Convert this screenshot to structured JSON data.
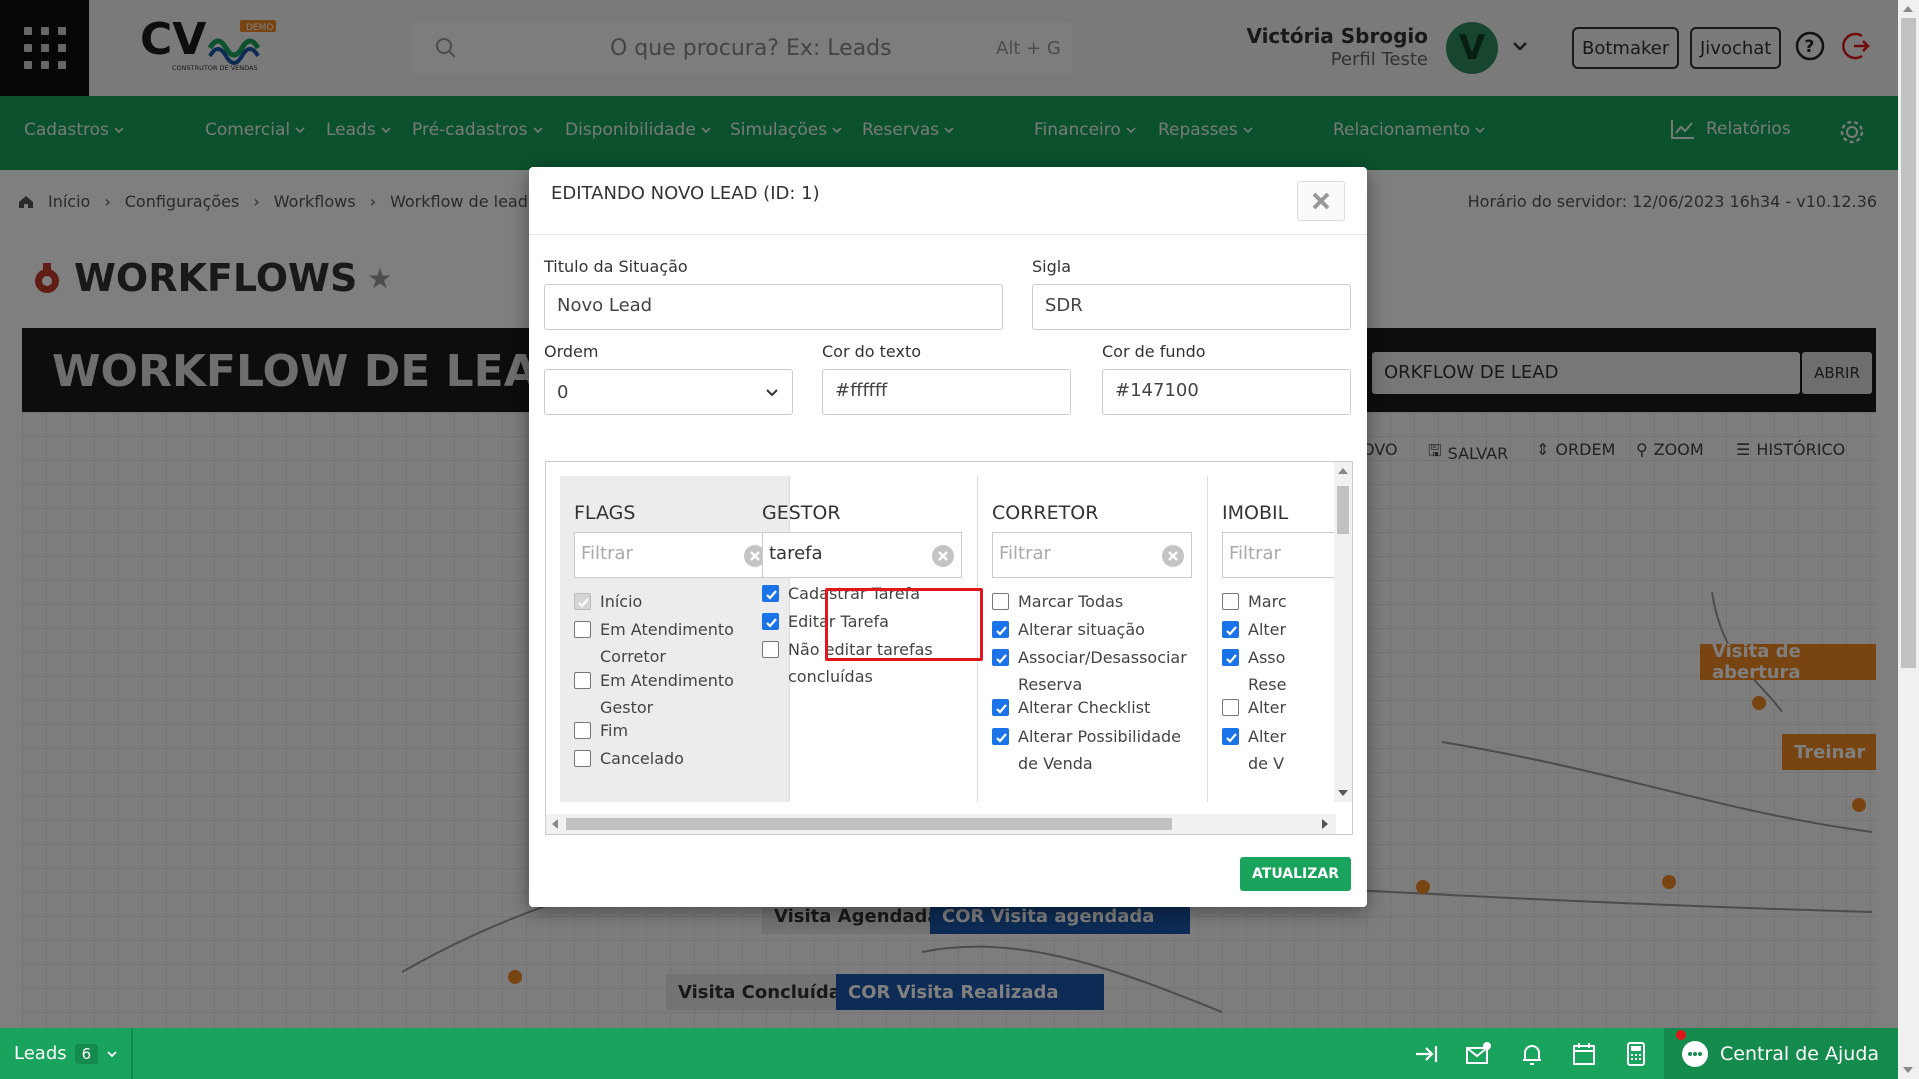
{
  "header": {
    "logo_text": "CV",
    "logo_tagline": "CONSTRUTOR DE VENDAS",
    "logo_badge": "DEMO",
    "search_placeholder": "O que procura? Ex: Leads",
    "search_shortcut": "Alt + G",
    "user_name": "Victória Sbrogio",
    "user_profile": "Perfil Teste",
    "avatar_letter": "V",
    "buttons": [
      "Botmaker",
      "Jivochat"
    ]
  },
  "nav": {
    "items": [
      "Cadastros",
      "Comercial",
      "Leads",
      "Pré-cadastros",
      "Disponibilidade",
      "Simulações",
      "Reservas",
      "Financeiro",
      "Repasses",
      "Relacionamento"
    ],
    "reports": "Relatórios"
  },
  "breadcrumb": [
    "Início",
    "Configurações",
    "Workflows",
    "Workflow de lead"
  ],
  "server_time": "Horário do servidor: 12/06/2023 16h34 - v10.12.36",
  "page_title": "WORKFLOWS",
  "workflow": {
    "banner": "WORKFLOW DE LEAD",
    "select_value": "ORKFLOW DE LEAD",
    "open_button": "ABRIR",
    "toolbar": [
      "OVO",
      "SALVAR",
      "ORDEM",
      "ZOOM",
      "HISTÓRICO"
    ],
    "nodes": [
      "Visita Agendada",
      "COR  Visita agendada",
      "Visita Concluída",
      "COR  Visita Realizada",
      "Visita de abertura",
      "Treinar"
    ]
  },
  "modal": {
    "title": "EDITANDO NOVO LEAD (ID: 1)",
    "fields": {
      "titulo_label": "Titulo da Situação",
      "titulo_value": "Novo Lead",
      "sigla_label": "Sigla",
      "sigla_value": "SDR",
      "ordem_label": "Ordem",
      "ordem_value": "0",
      "cor_texto_label": "Cor do texto",
      "cor_texto_value": "#ffffff",
      "cor_fundo_label": "Cor de fundo",
      "cor_fundo_value": "#147100"
    },
    "columns": [
      {
        "title": "FLAGS",
        "filter_placeholder": "Filtrar",
        "filter_value": "",
        "items": [
          {
            "label": "Início",
            "state": "disabled"
          },
          {
            "label": "Em Atendimento Corretor",
            "state": "off"
          },
          {
            "label": "Em Atendimento Gestor",
            "state": "off"
          },
          {
            "label": "Fim",
            "state": "off"
          },
          {
            "label": "Cancelado",
            "state": "off"
          }
        ]
      },
      {
        "title": "GESTOR",
        "filter_placeholder": "Filtrar",
        "filter_value": "tarefa",
        "items": [
          {
            "label": "Cadastrar Tarefa",
            "state": "on"
          },
          {
            "label": "Editar Tarefa",
            "state": "on"
          },
          {
            "label": "Não editar tarefas concluídas",
            "state": "off"
          }
        ]
      },
      {
        "title": "CORRETOR",
        "filter_placeholder": "Filtrar",
        "filter_value": "",
        "items": [
          {
            "label": "Marcar Todas",
            "state": "off"
          },
          {
            "label": "Alterar situação",
            "state": "on"
          },
          {
            "label": "Associar/Desassociar Reserva",
            "state": "on"
          },
          {
            "label": "Alterar Checklist",
            "state": "on"
          },
          {
            "label": "Alterar Possibilidade de Venda",
            "state": "on"
          }
        ]
      },
      {
        "title": "IMOBIL",
        "filter_placeholder": "Filtrar",
        "filter_value": "",
        "items": [
          {
            "label": "Marc",
            "state": "off"
          },
          {
            "label": "Alter",
            "state": "on"
          },
          {
            "label": "Asso Rese",
            "state": "on"
          },
          {
            "label": "Alter",
            "state": "off"
          },
          {
            "label": "Alter de V",
            "state": "on"
          }
        ]
      }
    ],
    "update_button": "ATUALIZAR"
  },
  "footer": {
    "leads_label": "Leads",
    "leads_count": "6",
    "help": "Central de Ajuda"
  },
  "colors": {
    "brand_green": "#1aa35d",
    "checkbox_blue": "#1a73e8",
    "highlight_red": "#e0161a"
  }
}
